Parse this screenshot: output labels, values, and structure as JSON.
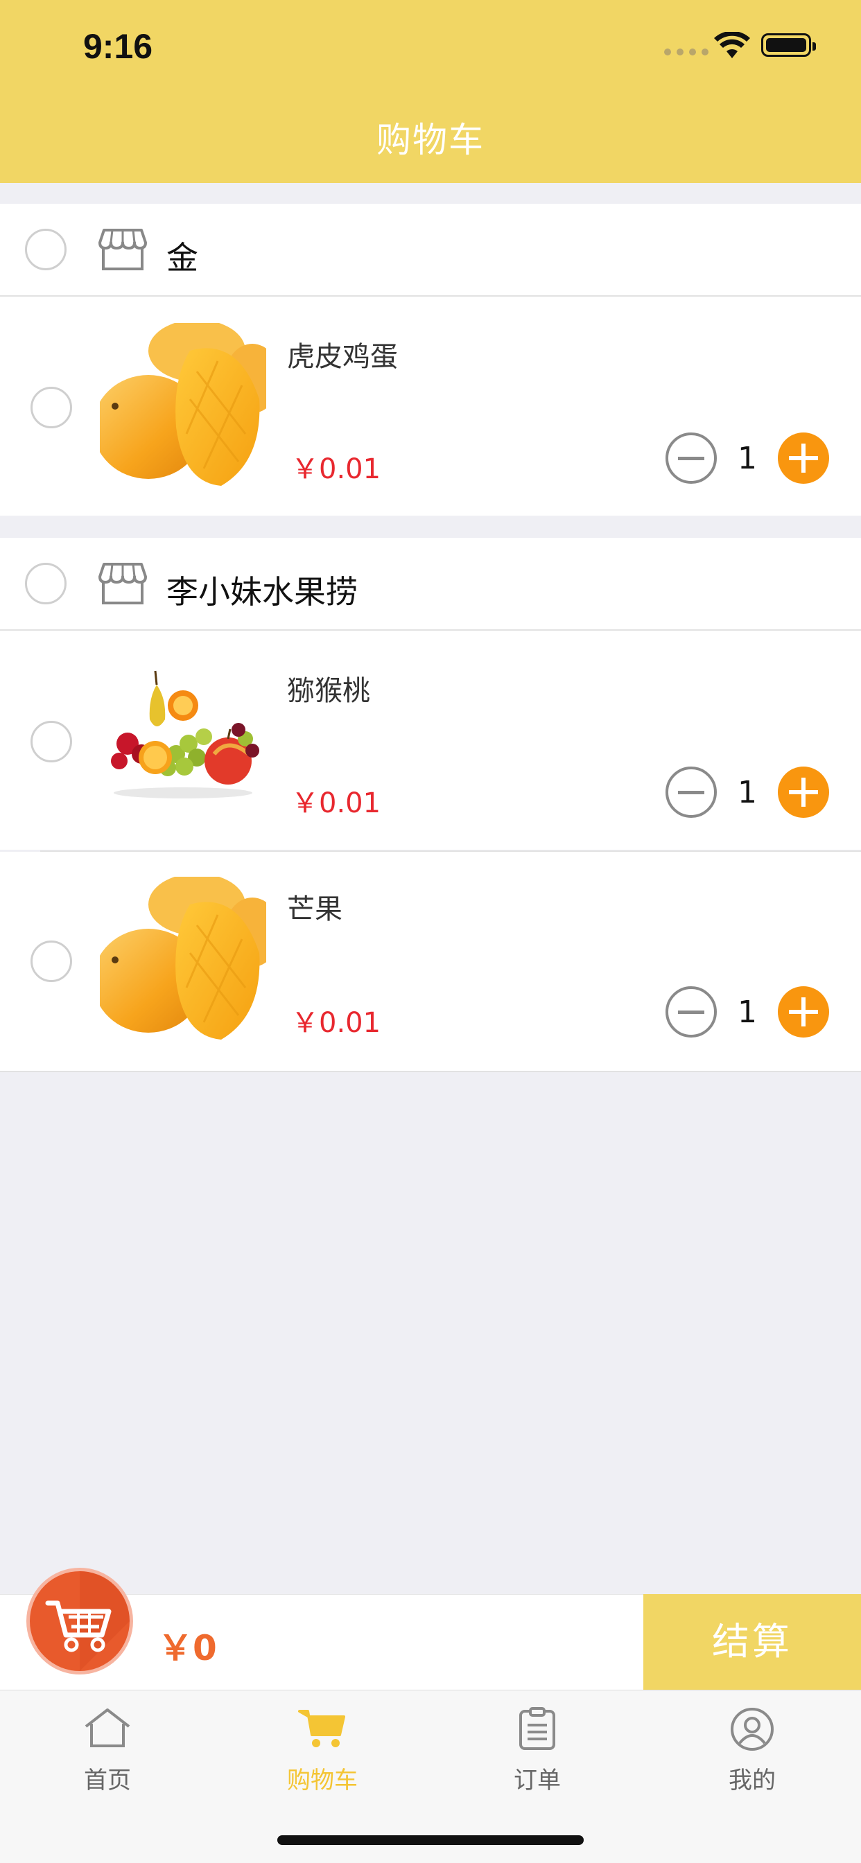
{
  "status_bar": {
    "time": "9:16"
  },
  "nav": {
    "title": "购物车"
  },
  "shops": [
    {
      "name": "金",
      "items": [
        {
          "name": "虎皮鸡蛋",
          "price": "￥0.01",
          "qty": "1",
          "image": "mango-photo"
        }
      ]
    },
    {
      "name": "李小妹水果捞",
      "items": [
        {
          "name": "猕猴桃",
          "price": "￥0.01",
          "qty": "1",
          "image": "mixed-fruit-photo"
        },
        {
          "name": "芒果",
          "price": "￥0.01",
          "qty": "1",
          "image": "mango-photo"
        }
      ]
    }
  ],
  "checkout": {
    "total": "￥0",
    "button_label": "结算"
  },
  "tabbar": {
    "items": [
      {
        "label": "首页",
        "icon": "home-icon",
        "active": false
      },
      {
        "label": "购物车",
        "icon": "cart-icon",
        "active": true
      },
      {
        "label": "订单",
        "icon": "clipboard-icon",
        "active": false
      },
      {
        "label": "我的",
        "icon": "user-icon",
        "active": false
      }
    ]
  },
  "colors": {
    "header": "#f1d664",
    "accent_orange": "#f9960f",
    "price_red": "#e8282f",
    "checkout_button": "#f1d664",
    "active_tab": "#f4c534"
  }
}
